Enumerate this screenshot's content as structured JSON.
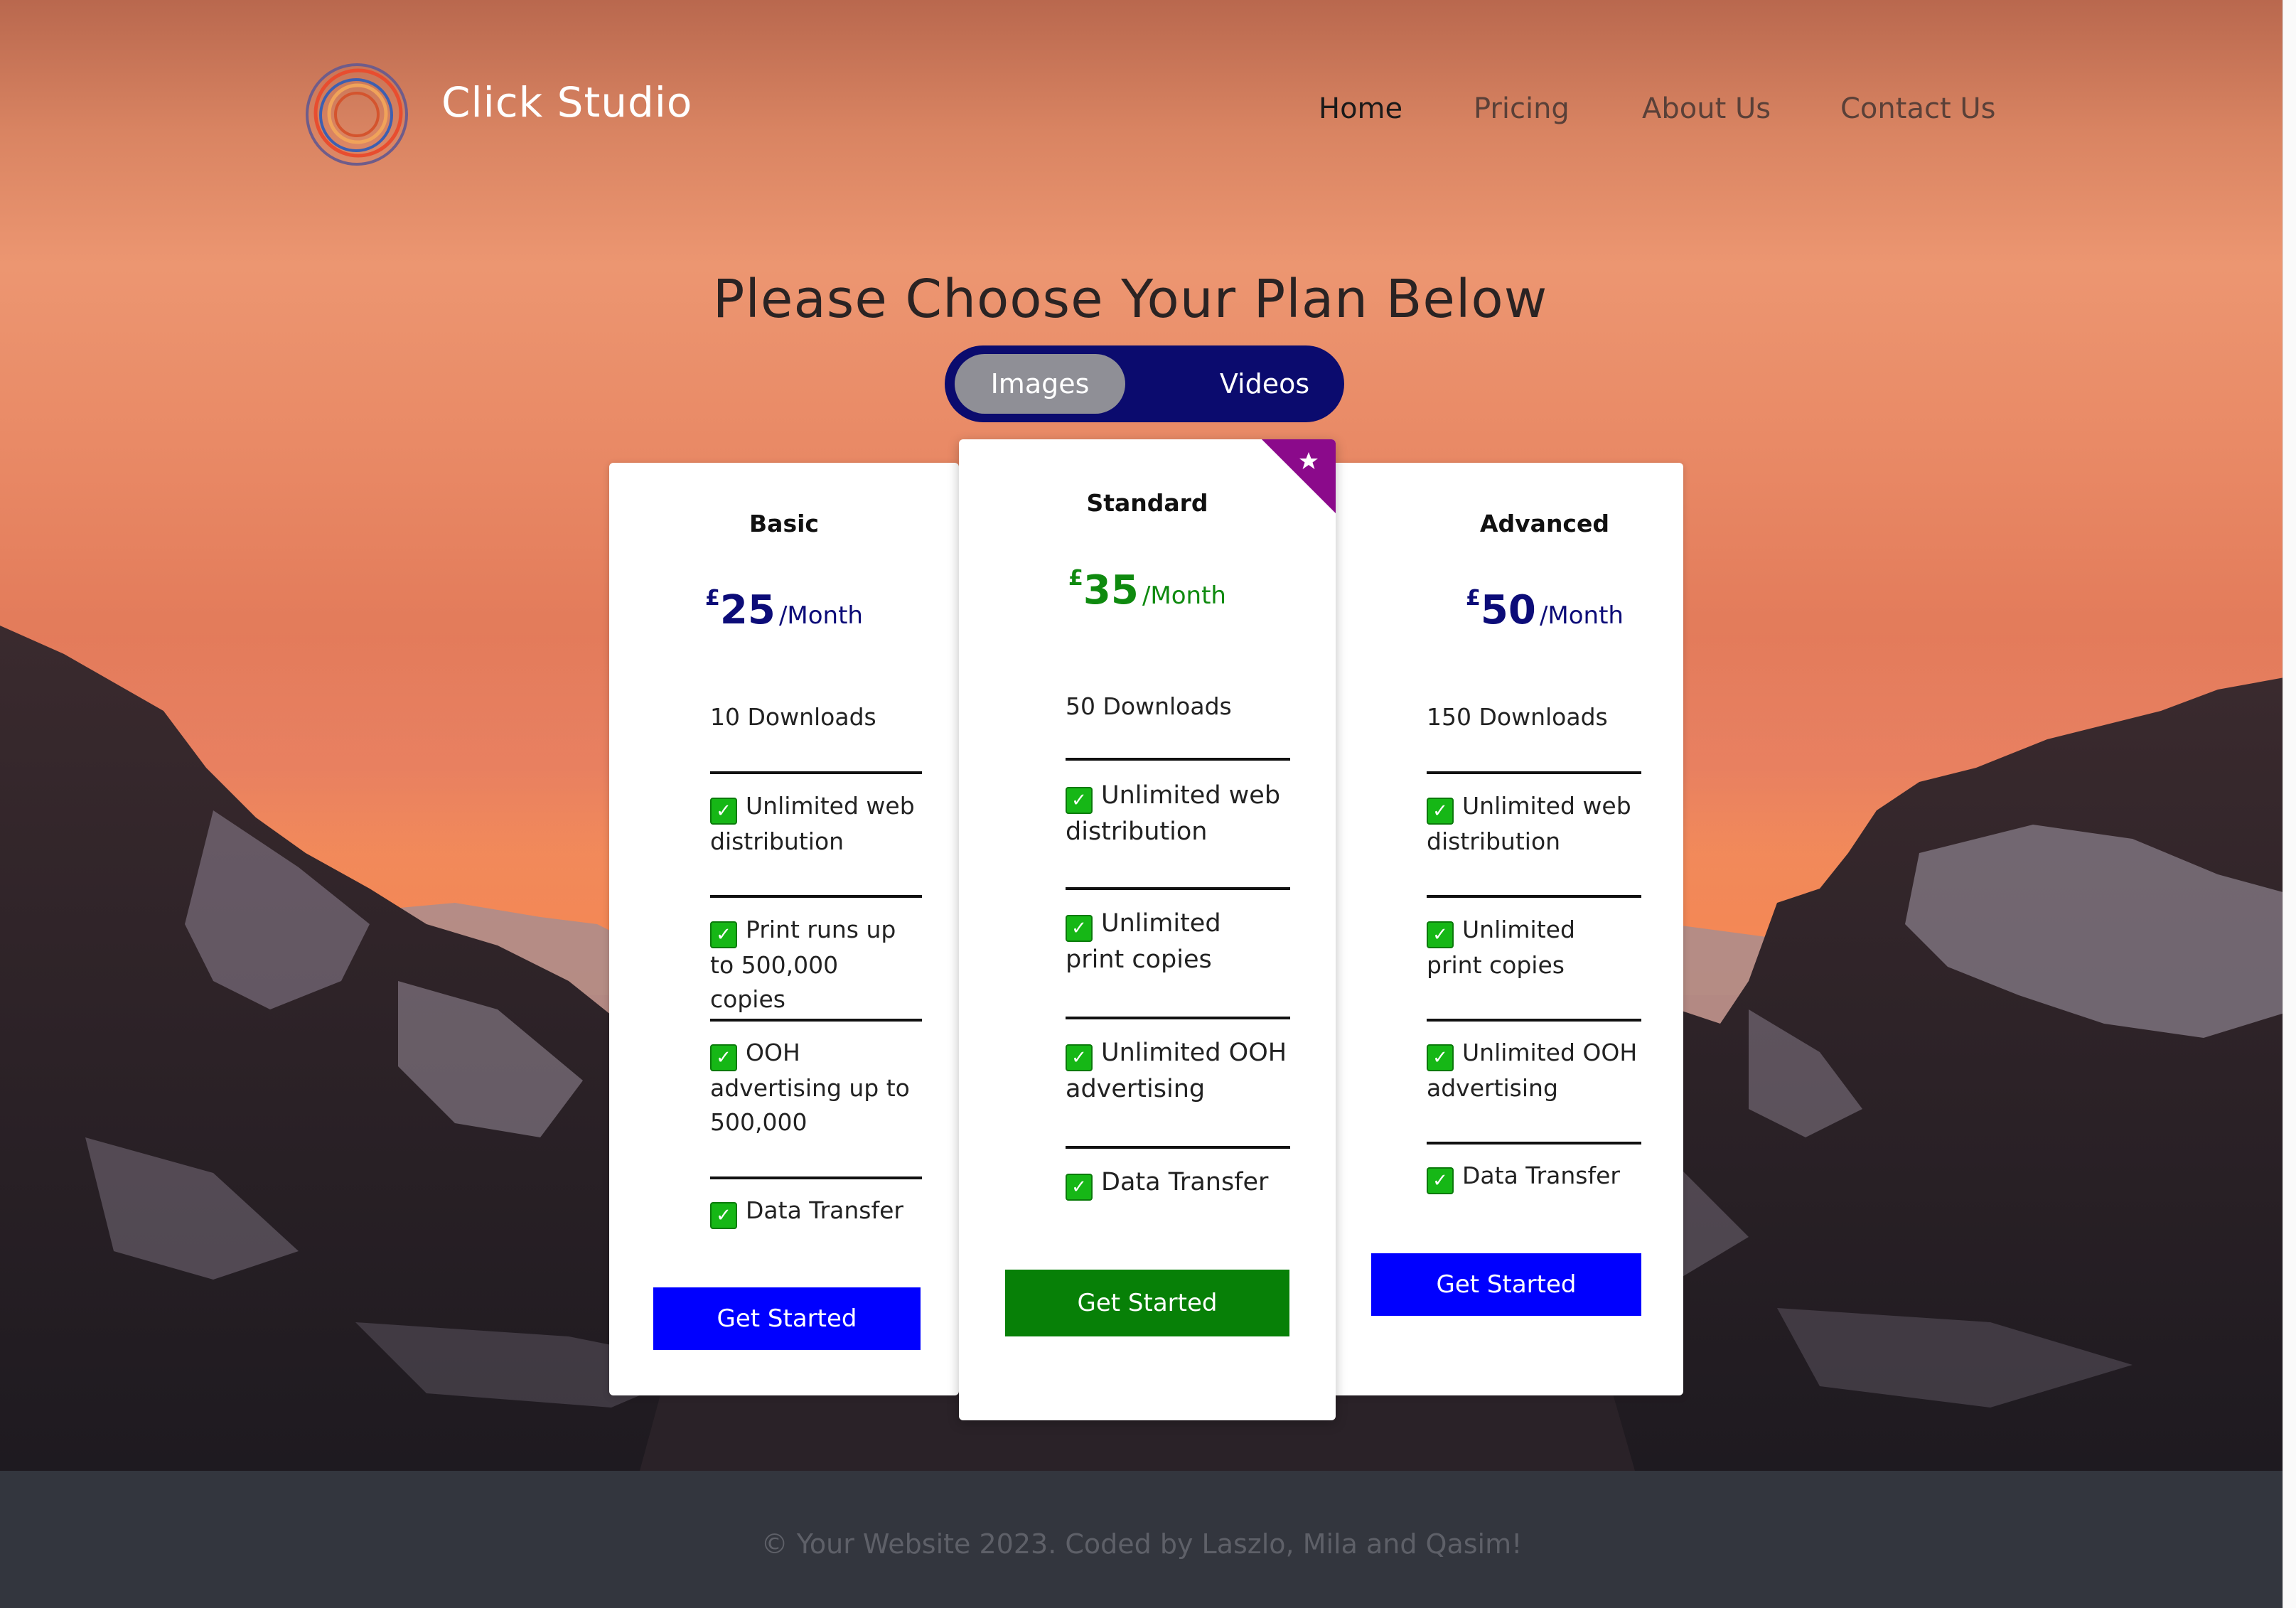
{
  "brand": {
    "name": "Click Studio",
    "logo_icon": "spiral-logo-icon"
  },
  "nav": {
    "items": [
      "Home",
      "Pricing",
      "About Us",
      "Contact Us"
    ],
    "active": "Home"
  },
  "headline": "Please Choose Your Plan Below",
  "toggle": {
    "options": [
      "Images",
      "Videos"
    ],
    "selected": "Images"
  },
  "plans": [
    {
      "name": "Basic",
      "currency": "£",
      "price": "25",
      "period": "/Month",
      "downloads": "10 Downloads",
      "features": [
        "Unlimited web distribution",
        "Print runs up to 500,000 copies",
        "OOH advertising up to 500,000",
        "Data Transfer"
      ],
      "button": "Get Started",
      "button_color": "#0000ff"
    },
    {
      "name": "Standard",
      "currency": "£",
      "price": "35",
      "period": "/Month",
      "downloads": "50 Downloads",
      "features": [
        "Unlimited web distribution",
        "Unlimited print copies",
        "Unlimited OOH advertising",
        "Data Transfer"
      ],
      "button": "Get Started",
      "button_color": "#078007",
      "badge_icon": "star-ribbon-icon",
      "badge_color": "#8b0a8b"
    },
    {
      "name": "Advanced",
      "currency": "£",
      "price": "50",
      "period": "/Month",
      "downloads": "150 Downloads",
      "features": [
        "Unlimited web distribution",
        "Unlimited print copies",
        "Unlimited OOH advertising",
        "Data Transfer"
      ],
      "button": "Get Started",
      "button_color": "#0000ff"
    }
  ],
  "feature_icon": "checkmark-icon",
  "footer": {
    "text": "© Your Website 2023. Coded by Laszlo, Mila and Qasim!"
  }
}
